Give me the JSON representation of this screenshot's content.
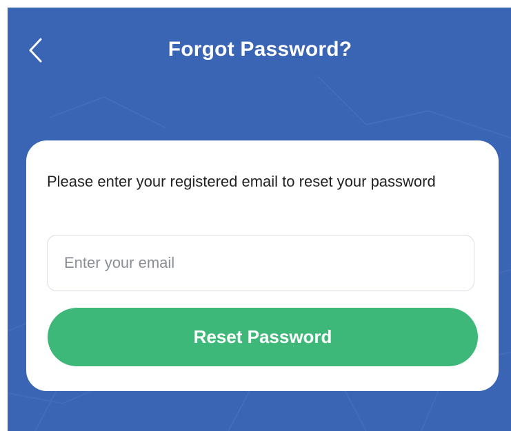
{
  "header": {
    "title": "Forgot Password?",
    "back_icon": "chevron-left-icon"
  },
  "card": {
    "instruction": "Please enter your registered email to reset your password",
    "email_placeholder": "Enter your email",
    "email_value": "",
    "button_label": "Reset Password"
  },
  "colors": {
    "background": "#3a64b4",
    "card": "#ffffff",
    "button": "#3eb878",
    "title_text": "#ffffff"
  }
}
